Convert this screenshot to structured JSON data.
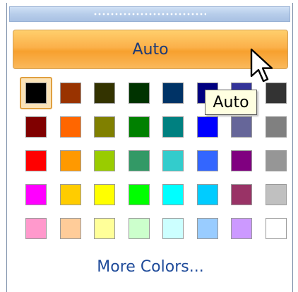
{
  "auto_button": {
    "label": "Auto"
  },
  "tooltip": {
    "text": "Auto"
  },
  "more_colors": {
    "label": "More Colors..."
  },
  "palette": {
    "selected_index": 0,
    "rows": [
      [
        "#000000",
        "#993300",
        "#333300",
        "#003300",
        "#003366",
        "#000080",
        "#333399",
        "#333333"
      ],
      [
        "#800000",
        "#ff6600",
        "#808000",
        "#008000",
        "#008080",
        "#0000ff",
        "#666699",
        "#808080"
      ],
      [
        "#ff0000",
        "#ff9900",
        "#99cc00",
        "#339966",
        "#33cccc",
        "#3366ff",
        "#800080",
        "#969696"
      ],
      [
        "#ff00ff",
        "#ffcc00",
        "#ffff00",
        "#00ff00",
        "#00ffff",
        "#00ccff",
        "#993366",
        "#c0c0c0"
      ],
      [
        "#ff99cc",
        "#ffcc99",
        "#ffff99",
        "#ccffcc",
        "#ccffff",
        "#99ccff",
        "#cc99ff",
        "#ffffff"
      ]
    ]
  },
  "icons": {
    "cursor": "arrow-pointer-icon",
    "grip": "drag-grip-icon"
  }
}
